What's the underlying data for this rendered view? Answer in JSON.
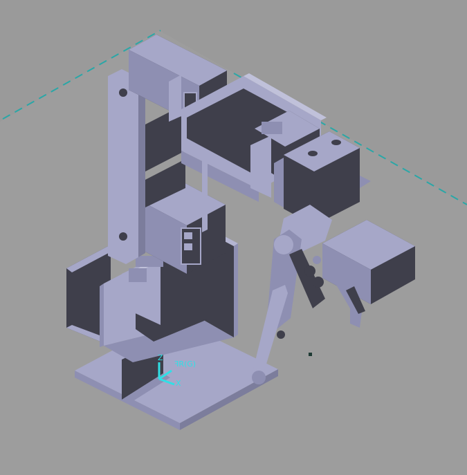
{
  "viewport": {
    "background": "#9a9a9a",
    "model_light": "#a6a7c8",
    "model_mid": "#8e8fb2",
    "model_dark": "#3f3f4b",
    "grid_color": "#2aa7a7",
    "triad_color": "#2fe0e6"
  },
  "triad": {
    "z_label": "Z",
    "x_label": "X",
    "ref_label": "ꟻR(G)"
  }
}
